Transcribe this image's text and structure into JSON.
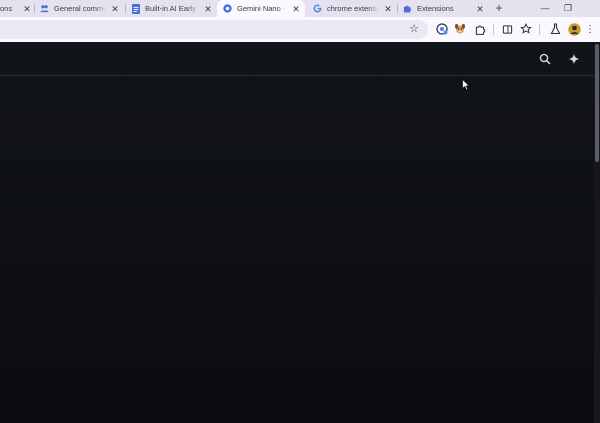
{
  "tabs": [
    {
      "title": "ons",
      "icon": "none",
      "active": false
    },
    {
      "title": "General comment",
      "icon": "people-icon",
      "active": false
    },
    {
      "title": "Built-in AI Early Pre",
      "icon": "doc-icon",
      "active": false
    },
    {
      "title": "Gemini Nano - Goo",
      "icon": "chrome-circle-icon",
      "active": true
    },
    {
      "title": "chrome extension",
      "icon": "google-g-icon",
      "active": false
    },
    {
      "title": "Extensions",
      "icon": "puzzle-icon",
      "active": false
    }
  ],
  "tab_close_glyph": "✕",
  "new_tab_glyph": "+",
  "window_controls": {
    "minimize": "—",
    "maximize": "❐"
  },
  "toolbar": {
    "bookmark_star_glyph": "☆",
    "icons": [
      "gemini-extension-icon",
      "dog-extension-icon",
      "puzzle-icon",
      "reading-list-icon",
      "bookmarks-icon",
      "labs-flask-icon",
      "profile-avatar-icon",
      "menu-dots-icon"
    ],
    "menu_glyph": "⋮"
  },
  "page": {
    "background": "#0d0f13",
    "header_icons": [
      "search-icon",
      "sparkle-icon"
    ]
  },
  "colors": {
    "tab_strip": "#e6e1ee",
    "toolbar": "#fbf8ff",
    "omnibox": "#ece8f3",
    "google_blue": "#4285f4",
    "docs_blue": "#4a6fd8"
  }
}
